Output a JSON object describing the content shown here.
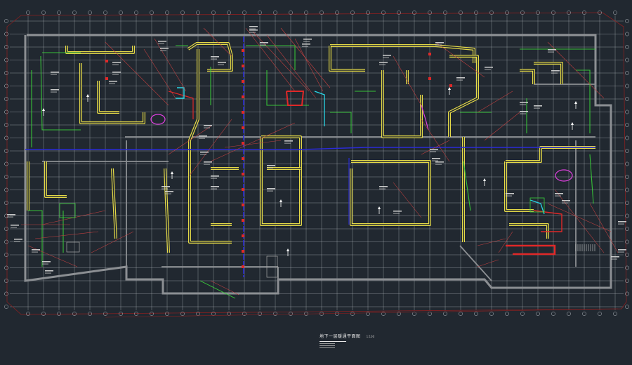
{
  "drawing": {
    "title": "地下一层暖通平面图",
    "scale": "1:100"
  },
  "colors": {
    "background": "#212830",
    "grid": "#b9bec4",
    "wall": "#8c8f93",
    "duct_yellow": "#f0e44a",
    "duct_green": "#3ad23a",
    "pipe_blue": "#2b2bd8",
    "pipe_red": "#e02828",
    "pipe_magenta": "#e040e0",
    "pipe_cyan": "#2ad6e6",
    "leader_red": "#c04040",
    "leader_white": "#d8d8d8"
  }
}
